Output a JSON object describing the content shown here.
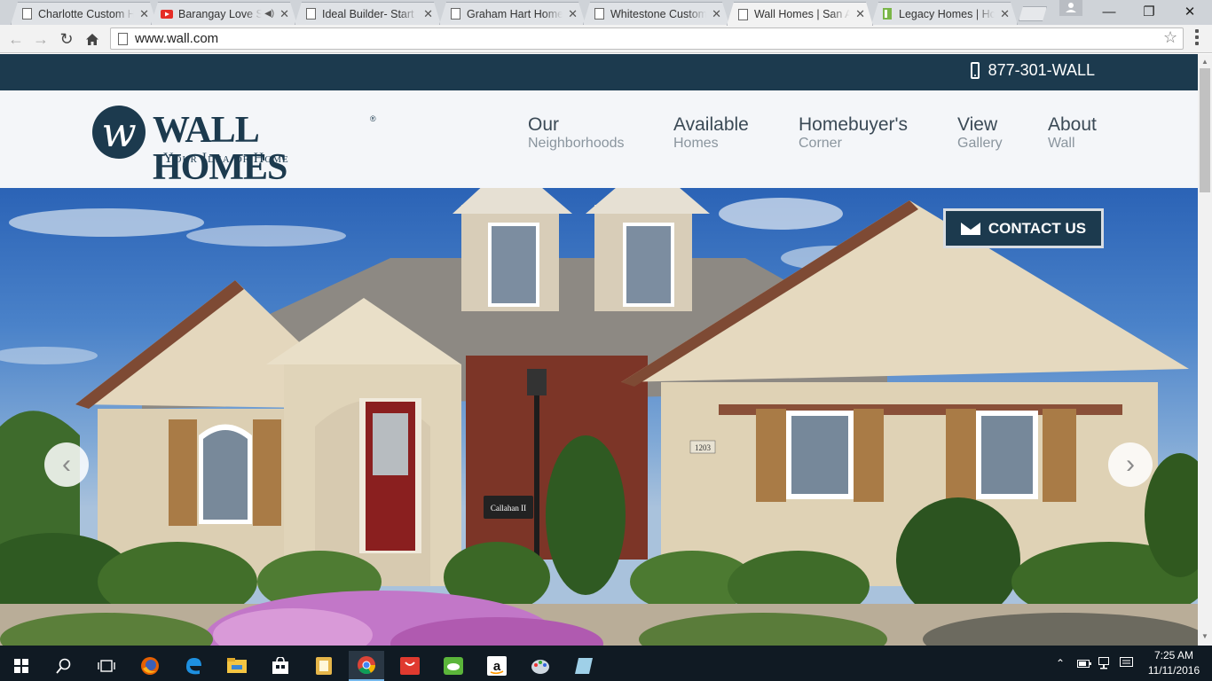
{
  "browser": {
    "tabs": [
      {
        "title": "Charlotte Custom Ho",
        "icon": "page-icon"
      },
      {
        "title": "Barangay Love St",
        "icon": "youtube-icon"
      },
      {
        "title": "Ideal Builder- Start B",
        "icon": "page-icon"
      },
      {
        "title": "Graham Hart Home",
        "icon": "page-icon"
      },
      {
        "title": "Whitestone Custom",
        "icon": "page-icon"
      },
      {
        "title": "Wall Homes | San An",
        "icon": "page-icon",
        "active": true
      },
      {
        "title": "Legacy Homes | Hor",
        "icon": "legacy-icon"
      }
    ],
    "url": "www.wall.com",
    "window_controls": {
      "minimize": "—",
      "maximize": "❐",
      "close": "✕"
    }
  },
  "site": {
    "phone": "877-301-WALL",
    "logo": {
      "mark": "w",
      "name": "WALL HOMES",
      "reg": "®",
      "tagline": "Your Idea of Home"
    },
    "nav": [
      {
        "line1": "Our",
        "line2": "Neighborhoods"
      },
      {
        "line1": "Available",
        "line2": "Homes"
      },
      {
        "line1": "Homebuyer's",
        "line2": "Corner"
      },
      {
        "line1": "View",
        "line2": "Gallery"
      },
      {
        "line1": "About",
        "line2": "Wall"
      }
    ],
    "contact_label": "CONTACT US",
    "hero": {
      "house_number": "1203",
      "model_sign": "Callahan II",
      "prev_arrow": "‹",
      "next_arrow": "›"
    },
    "colors": {
      "brand_navy": "#1c3a4e",
      "header_bg": "#f4f6f9"
    }
  },
  "taskbar": {
    "time": "7:25 AM",
    "date": "11/11/2016",
    "icons": [
      "windows-start-icon",
      "search-icon",
      "task-view-icon",
      "firefox-icon",
      "edge-icon",
      "file-explorer-icon",
      "store-icon",
      "sticky-app-icon",
      "chrome-icon",
      "shopping-bag-icon",
      "game-icon",
      "amazon-icon",
      "paint-icon",
      "notes-icon"
    ]
  }
}
